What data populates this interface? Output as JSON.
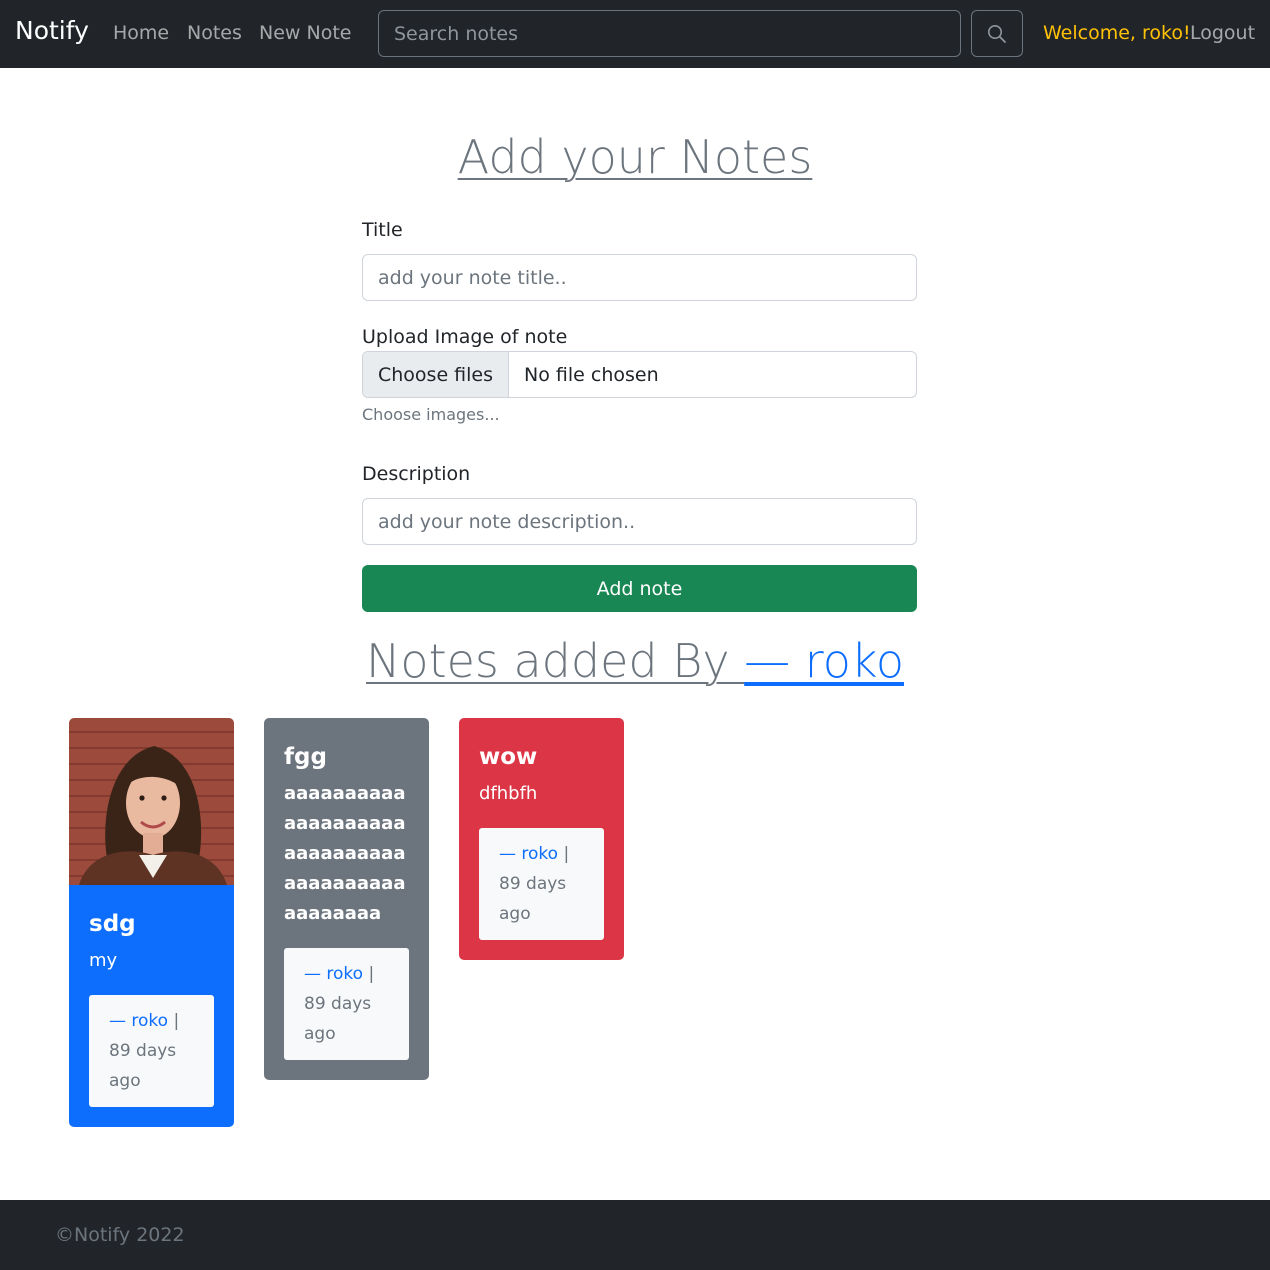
{
  "navbar": {
    "brand": "Notify",
    "links": [
      "Home",
      "Notes",
      "New Note"
    ],
    "search_placeholder": "Search notes",
    "welcome": "Welcome, roko!",
    "logout": "Logout"
  },
  "form": {
    "heading": "Add your Notes",
    "title_label": "Title",
    "title_placeholder": "add your note title..",
    "upload_label": "Upload Image of note",
    "file_button": "Choose files",
    "file_status": "No file chosen",
    "file_help": "Choose images...",
    "description_label": "Description",
    "description_placeholder": "add your note description..",
    "submit_label": "Add note"
  },
  "notes_section": {
    "heading_prefix": "Notes added By ",
    "heading_user": "— roko"
  },
  "notes": [
    {
      "title": "sdg",
      "text": "my",
      "author": "— roko",
      "separator": " |",
      "time": "89 days ago",
      "color": "#0d6efd",
      "has_image": true
    },
    {
      "title": "fgg",
      "text": "aaaaaaaaaaaaaaaaaaaaaaaaaaaaaaaaaaaaaaaaaaaaaaaa",
      "author": "— roko",
      "separator": " |",
      "time": "89 days ago",
      "color": "#6c757d",
      "has_image": false
    },
    {
      "title": "wow",
      "text": "dfhbfh",
      "author": "— roko",
      "separator": " |",
      "time": "89 days ago",
      "color": "#dc3545",
      "has_image": false
    }
  ],
  "footer": {
    "text": "©Notify 2022"
  },
  "colors": {
    "navbar": "#212529",
    "success": "#198754",
    "warning": "#ffc107",
    "primary": "#0d6efd"
  }
}
